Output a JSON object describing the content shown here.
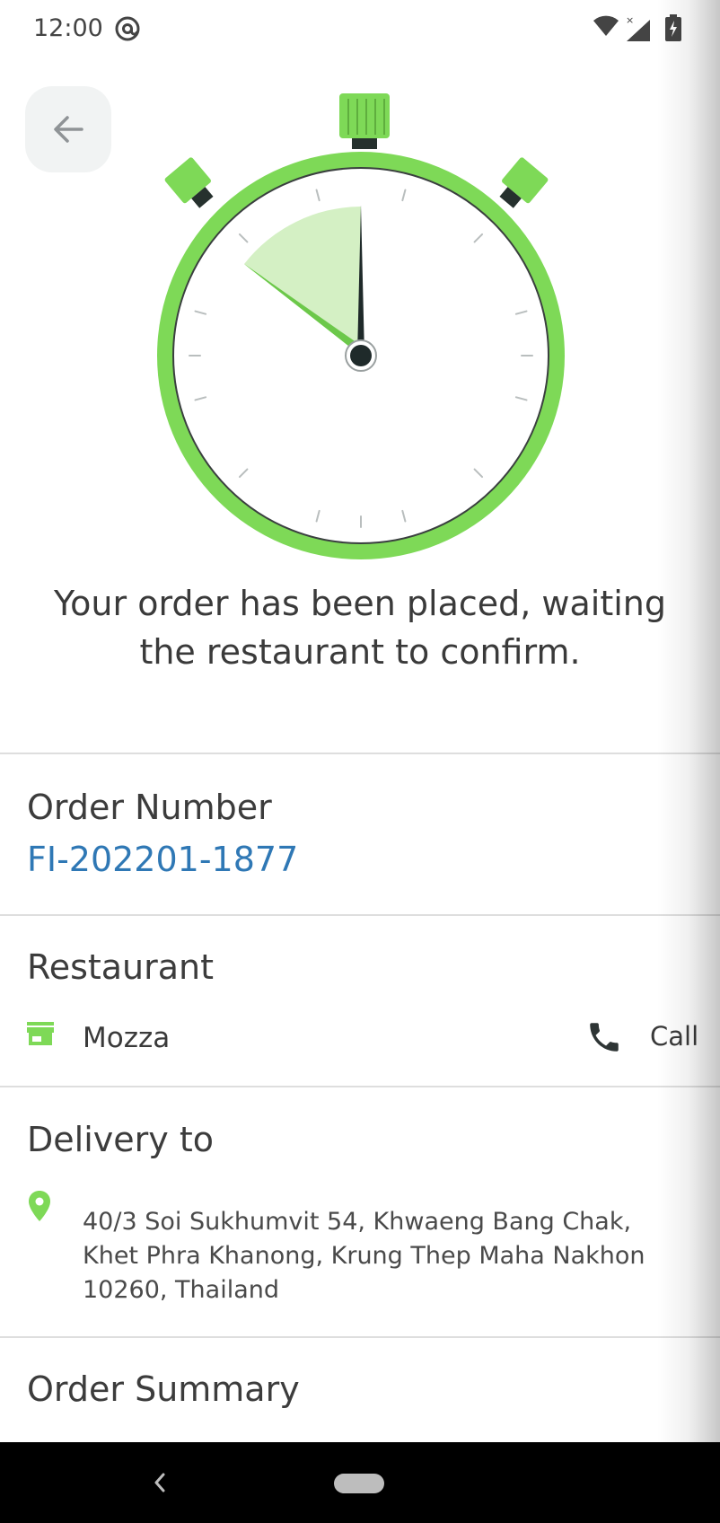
{
  "status_bar": {
    "time": "12:00",
    "icons": [
      "at-sign-icon",
      "wifi-icon",
      "signal-icon",
      "battery-charging-icon"
    ]
  },
  "header": {
    "back_icon": "arrow-left-icon"
  },
  "illustration": "stopwatch-icon",
  "headline": "Your order has been placed, waiting the restaurant to confirm.",
  "order": {
    "title": "Order Number",
    "number": "FI-202201-1877"
  },
  "restaurant": {
    "title": "Restaurant",
    "icon": "store-icon",
    "name": "Mozza",
    "call_icon": "phone-icon",
    "call_label": "Call"
  },
  "delivery": {
    "title": "Delivery to",
    "icon": "location-pin-icon",
    "address": "40/3 Soi Sukhumvit 54, Khwaeng Bang Chak, Khet Phra Khanong, Krung Thep Maha Nakhon 10260, Thailand"
  },
  "summary": {
    "title": "Order Summary"
  },
  "colors": {
    "accent_green": "#7ed957",
    "link_blue": "#2f78b5",
    "text_dark": "#3a3a3a"
  }
}
